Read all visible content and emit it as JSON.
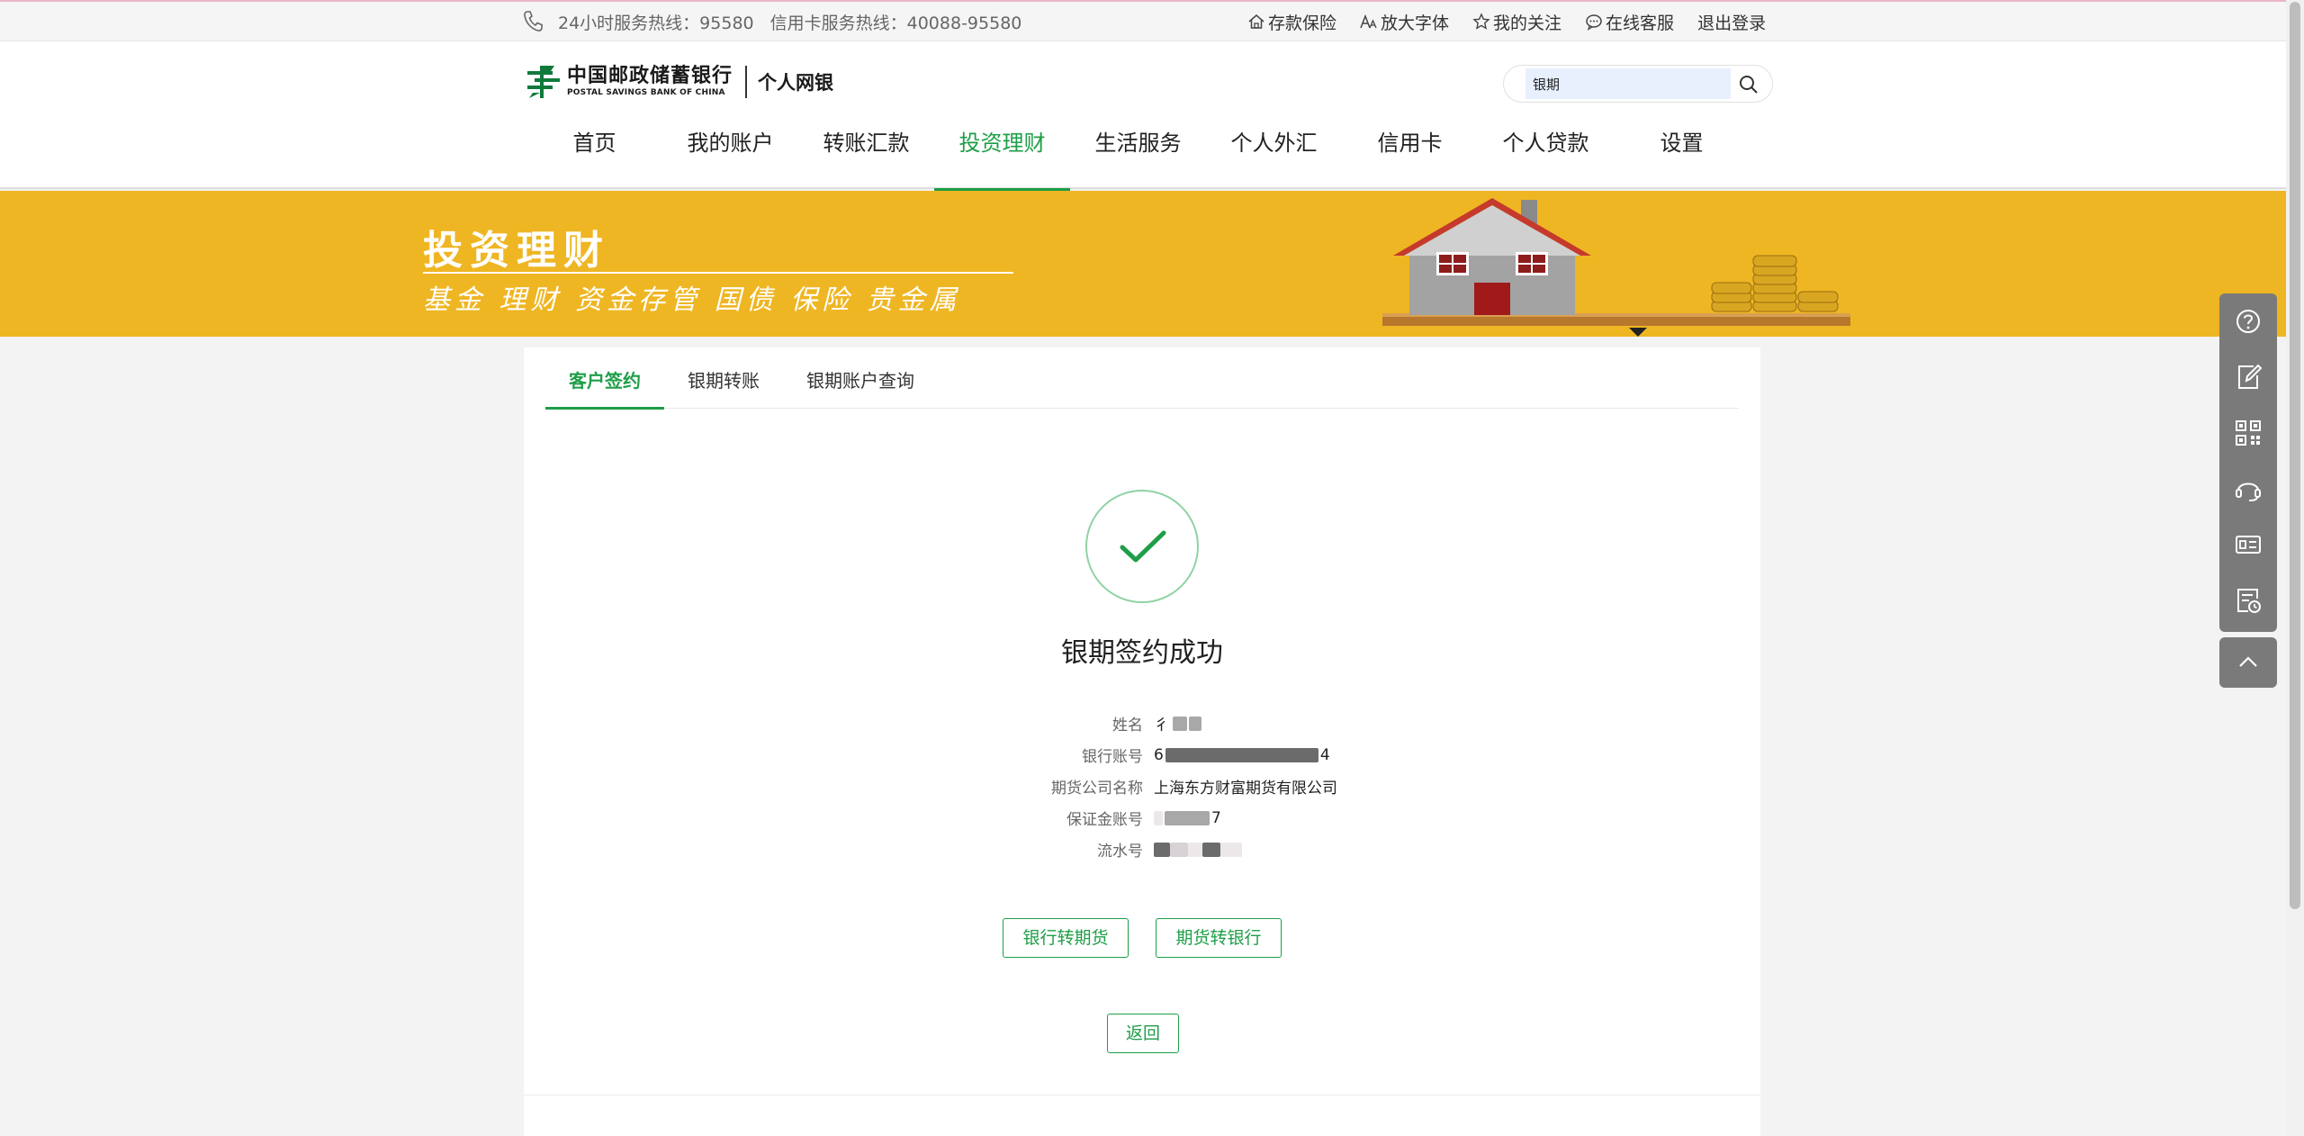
{
  "topbar": {
    "hotline": "24小时服务热线：95580",
    "credit_hotline": "信用卡服务热线：40088-95580",
    "links": [
      {
        "label": "存款保险",
        "icon": "home-icon"
      },
      {
        "label": "放大字体",
        "icon": "font-size-icon"
      },
      {
        "label": "我的关注",
        "icon": "star-icon"
      },
      {
        "label": "在线客服",
        "icon": "chat-icon"
      },
      {
        "label": "退出登录",
        "icon": ""
      }
    ]
  },
  "header": {
    "bank_name_cn": "中国邮政储蓄银行",
    "bank_name_en": "POSTAL SAVINGS BANK OF CHINA",
    "product": "个人网银",
    "search_value": "银期"
  },
  "nav": {
    "items": [
      "首页",
      "我的账户",
      "转账汇款",
      "投资理财",
      "生活服务",
      "个人外汇",
      "信用卡",
      "个人贷款",
      "设置"
    ],
    "active": "投资理财"
  },
  "banner": {
    "title": "投资理财",
    "subtitle": "基金 理财 资金存管 国债 保险 贵金属"
  },
  "tabs": {
    "items": [
      "客户签约",
      "银期转账",
      "银期账户查询"
    ],
    "active": "客户签约"
  },
  "result": {
    "title": "银期签约成功",
    "rows": [
      {
        "label": "姓名",
        "value": "彳"
      },
      {
        "label": "银行账号",
        "value": "6"
      },
      {
        "label": "期货公司名称",
        "value": "上海东方财富期货有限公司"
      },
      {
        "label": "保证金账号",
        "value": "7"
      },
      {
        "label": "流水号",
        "value": ""
      }
    ]
  },
  "actions": {
    "bank_to_futures": "银行转期货",
    "futures_to_bank": "期货转银行",
    "back": "返回"
  },
  "colors": {
    "brand_green": "#1e9e48",
    "banner_yellow": "#efb623",
    "toolbar_gray": "#7a7a7a"
  },
  "float_toolbar": [
    "help-icon",
    "edit-icon",
    "qrcode-icon",
    "headset-icon",
    "card-icon",
    "record-icon",
    "back-to-top-icon"
  ]
}
